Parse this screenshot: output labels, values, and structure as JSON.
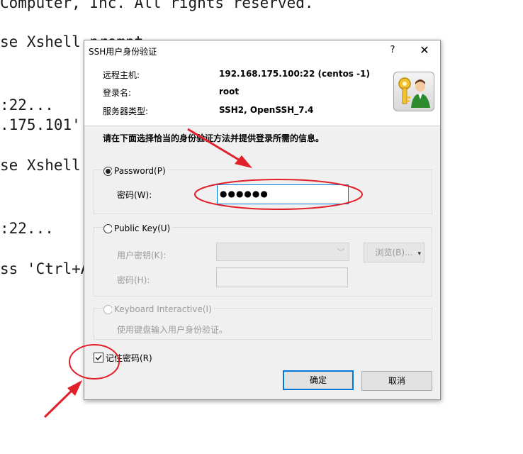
{
  "terminal": {
    "lines": [
      "Computer, Inc. All rights reserved.",
      "se Xshell prompt",
      ":22...",
      ".175.101'",
      "se Xshell",
      ":22...",
      "ss 'Ctrl+A"
    ]
  },
  "dialog": {
    "title": "SSH用户身份验证",
    "help": "?",
    "close": "✕",
    "info": {
      "host_label": "远程主机:",
      "host_value": "192.168.175.100:22 (centos -1)",
      "user_label": "登录名:",
      "user_value": "root",
      "server_label": "服务器类型:",
      "server_value": "SSH2, OpenSSH_7.4"
    },
    "instruction": "请在下面选择恰当的身份验证方法并提供登录所需的信息。",
    "password_group": {
      "label": "Password(P)",
      "field_label": "密码(W):",
      "field_value": "●●●●●●"
    },
    "pubkey_group": {
      "label": "Public Key(U)",
      "key_label": "用户密钥(K):",
      "browse_label": "浏览(B)...",
      "pass_label": "密码(H):"
    },
    "kbd_group": {
      "label": "Keyboard Interactive(I)",
      "desc": "使用键盘输入用户身份验证。"
    },
    "remember_label": "记住密码(R)",
    "ok_label": "确定",
    "cancel_label": "取消"
  },
  "colors": {
    "annotation": "#e0202a",
    "focus_border": "#0078d7"
  }
}
